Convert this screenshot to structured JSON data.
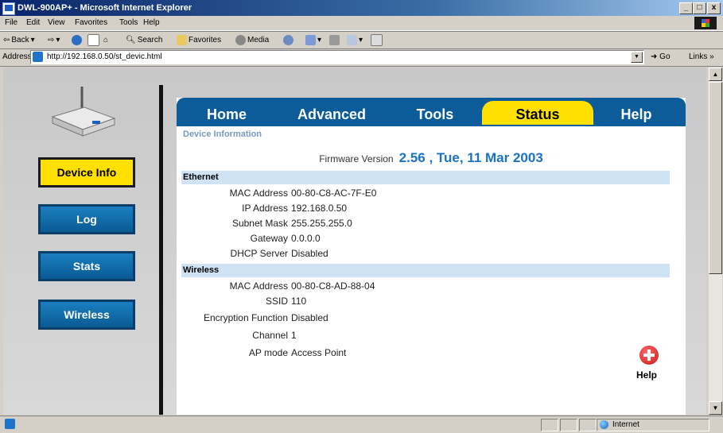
{
  "window": {
    "title": "DWL-900AP+ - Microsoft Internet Explorer",
    "min": "_",
    "max": "□",
    "close": "x"
  },
  "menu": [
    "File",
    "Edit",
    "View",
    "Favorites",
    "Tools",
    "Help"
  ],
  "toolbar": {
    "back": "Back",
    "search": "Search",
    "favorites": "Favorites",
    "media": "Media"
  },
  "address": {
    "label": "Address",
    "url": "http://192.168.0.50/st_devic.html",
    "go": "Go",
    "links": "Links »"
  },
  "sidebar": {
    "items": [
      {
        "label": "Device Info",
        "active": true
      },
      {
        "label": "Log",
        "active": false
      },
      {
        "label": "Stats",
        "active": false
      },
      {
        "label": "Wireless",
        "active": false
      }
    ]
  },
  "tabs": [
    {
      "label": "Home",
      "active": false
    },
    {
      "label": "Advanced",
      "active": false
    },
    {
      "label": "Tools",
      "active": false
    },
    {
      "label": "Status",
      "active": true
    },
    {
      "label": "Help",
      "active": false
    }
  ],
  "breadcrumb": "Device Information",
  "firmware": {
    "label": "Firmware Version",
    "value": "2.56 , Tue, 11 Mar 2003"
  },
  "ethernet": {
    "header": "Ethernet",
    "rows": [
      {
        "label": "MAC Address",
        "value": "00-80-C8-AC-7F-E0"
      },
      {
        "label": "IP Address",
        "value": "192.168.0.50"
      },
      {
        "label": "Subnet Mask",
        "value": "255.255.255.0"
      },
      {
        "label": "Gateway",
        "value": "0.0.0.0"
      },
      {
        "label": "DHCP Server",
        "value": "Disabled"
      }
    ]
  },
  "wireless": {
    "header": "Wireless",
    "rows": [
      {
        "label": "MAC Address",
        "value": "00-80-C8-AD-88-04"
      },
      {
        "label": "SSID",
        "value": "110"
      },
      {
        "label": "Encryption Function",
        "value": "Disabled"
      },
      {
        "label": "Channel",
        "value": "1"
      },
      {
        "label": "AP mode",
        "value": "Access Point"
      }
    ]
  },
  "help": {
    "label": "Help"
  },
  "status": {
    "zone": "Internet"
  },
  "colors": {
    "accent": "#ffe000",
    "tab_bar": "#0b5c99",
    "firmware": "#1a73c4",
    "section": "#cfe3f5"
  }
}
